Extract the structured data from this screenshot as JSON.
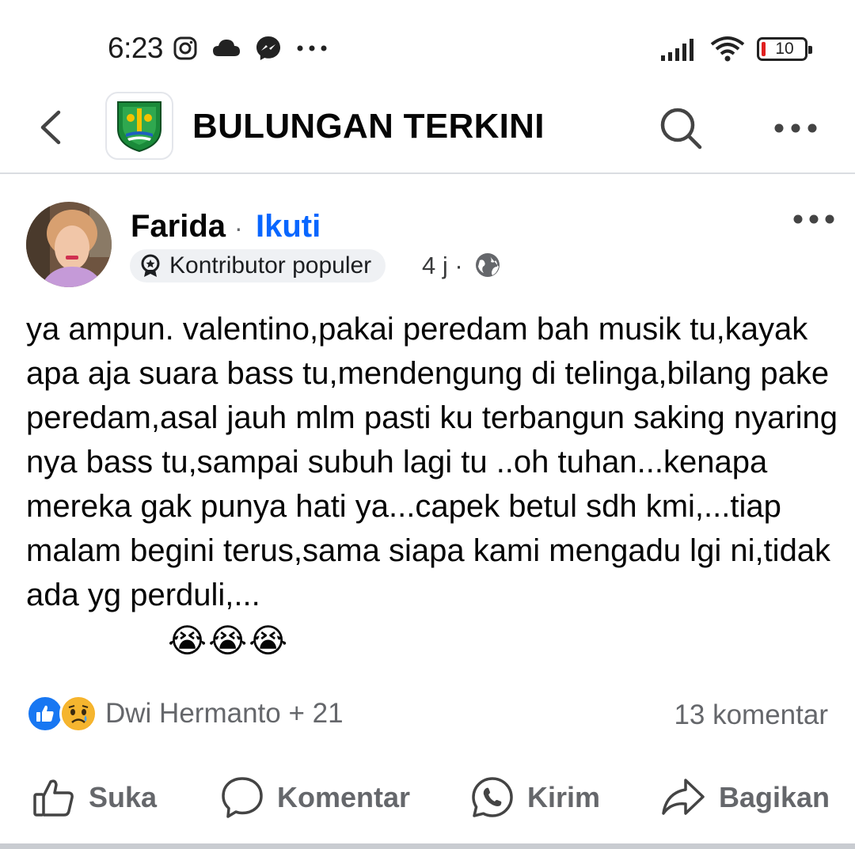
{
  "status_bar": {
    "time": "6:23",
    "battery": "10",
    "icons": [
      "instagram-icon",
      "cloud-icon",
      "messenger-icon",
      "more-dots-icon",
      "signal-icon",
      "wifi-icon",
      "battery-icon"
    ]
  },
  "header": {
    "title": "BULUNGAN TERKINI",
    "icons": [
      "back-icon",
      "page-logo",
      "search-icon",
      "more-icon"
    ]
  },
  "post": {
    "author": "Farida",
    "separator": "·",
    "follow_label": "Ikuti",
    "badge_label": "Kontributor populer",
    "time": "4 j ·",
    "body": "ya ampun. valentino,pakai peredam bah musik tu,kayak apa aja suara bass tu,mendengung di telinga,bilang pake peredam,asal jauh mlm pasti ku terbangun saking nyaring nya bass tu,sampai subuh lagi tu ..oh tuhan...kenapa mereka gak punya hati ya...capek betul sdh kmi,...tiap malam begini terus,sama siapa kami mengadu lgi ni,tidak ada yg perduli,...",
    "emojis": [
      "😭",
      "😭",
      "😭"
    ],
    "reactions_text": "Dwi Hermanto + 21",
    "comments_text": "13 komentar"
  },
  "actions": {
    "like_label": "Suka",
    "comment_label": "Komentar",
    "send_label": "Kirim",
    "share_label": "Bagikan"
  },
  "colors": {
    "accent": "#0866ff",
    "secondary_text": "#65676b",
    "divider": "#dadde1"
  }
}
